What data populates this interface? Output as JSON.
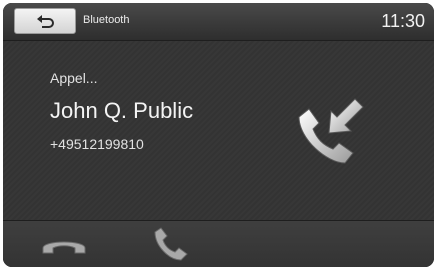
{
  "header": {
    "back_icon": "back-arrow-icon",
    "title": "Bluetooth",
    "time": "11:30"
  },
  "call": {
    "status": "Appel...",
    "caller_name": "John Q. Public",
    "phone_number": "+49512199810",
    "status_icon": "incoming-call-icon"
  },
  "actions": {
    "reject_icon": "hang-up-icon",
    "accept_icon": "accept-call-icon"
  }
}
